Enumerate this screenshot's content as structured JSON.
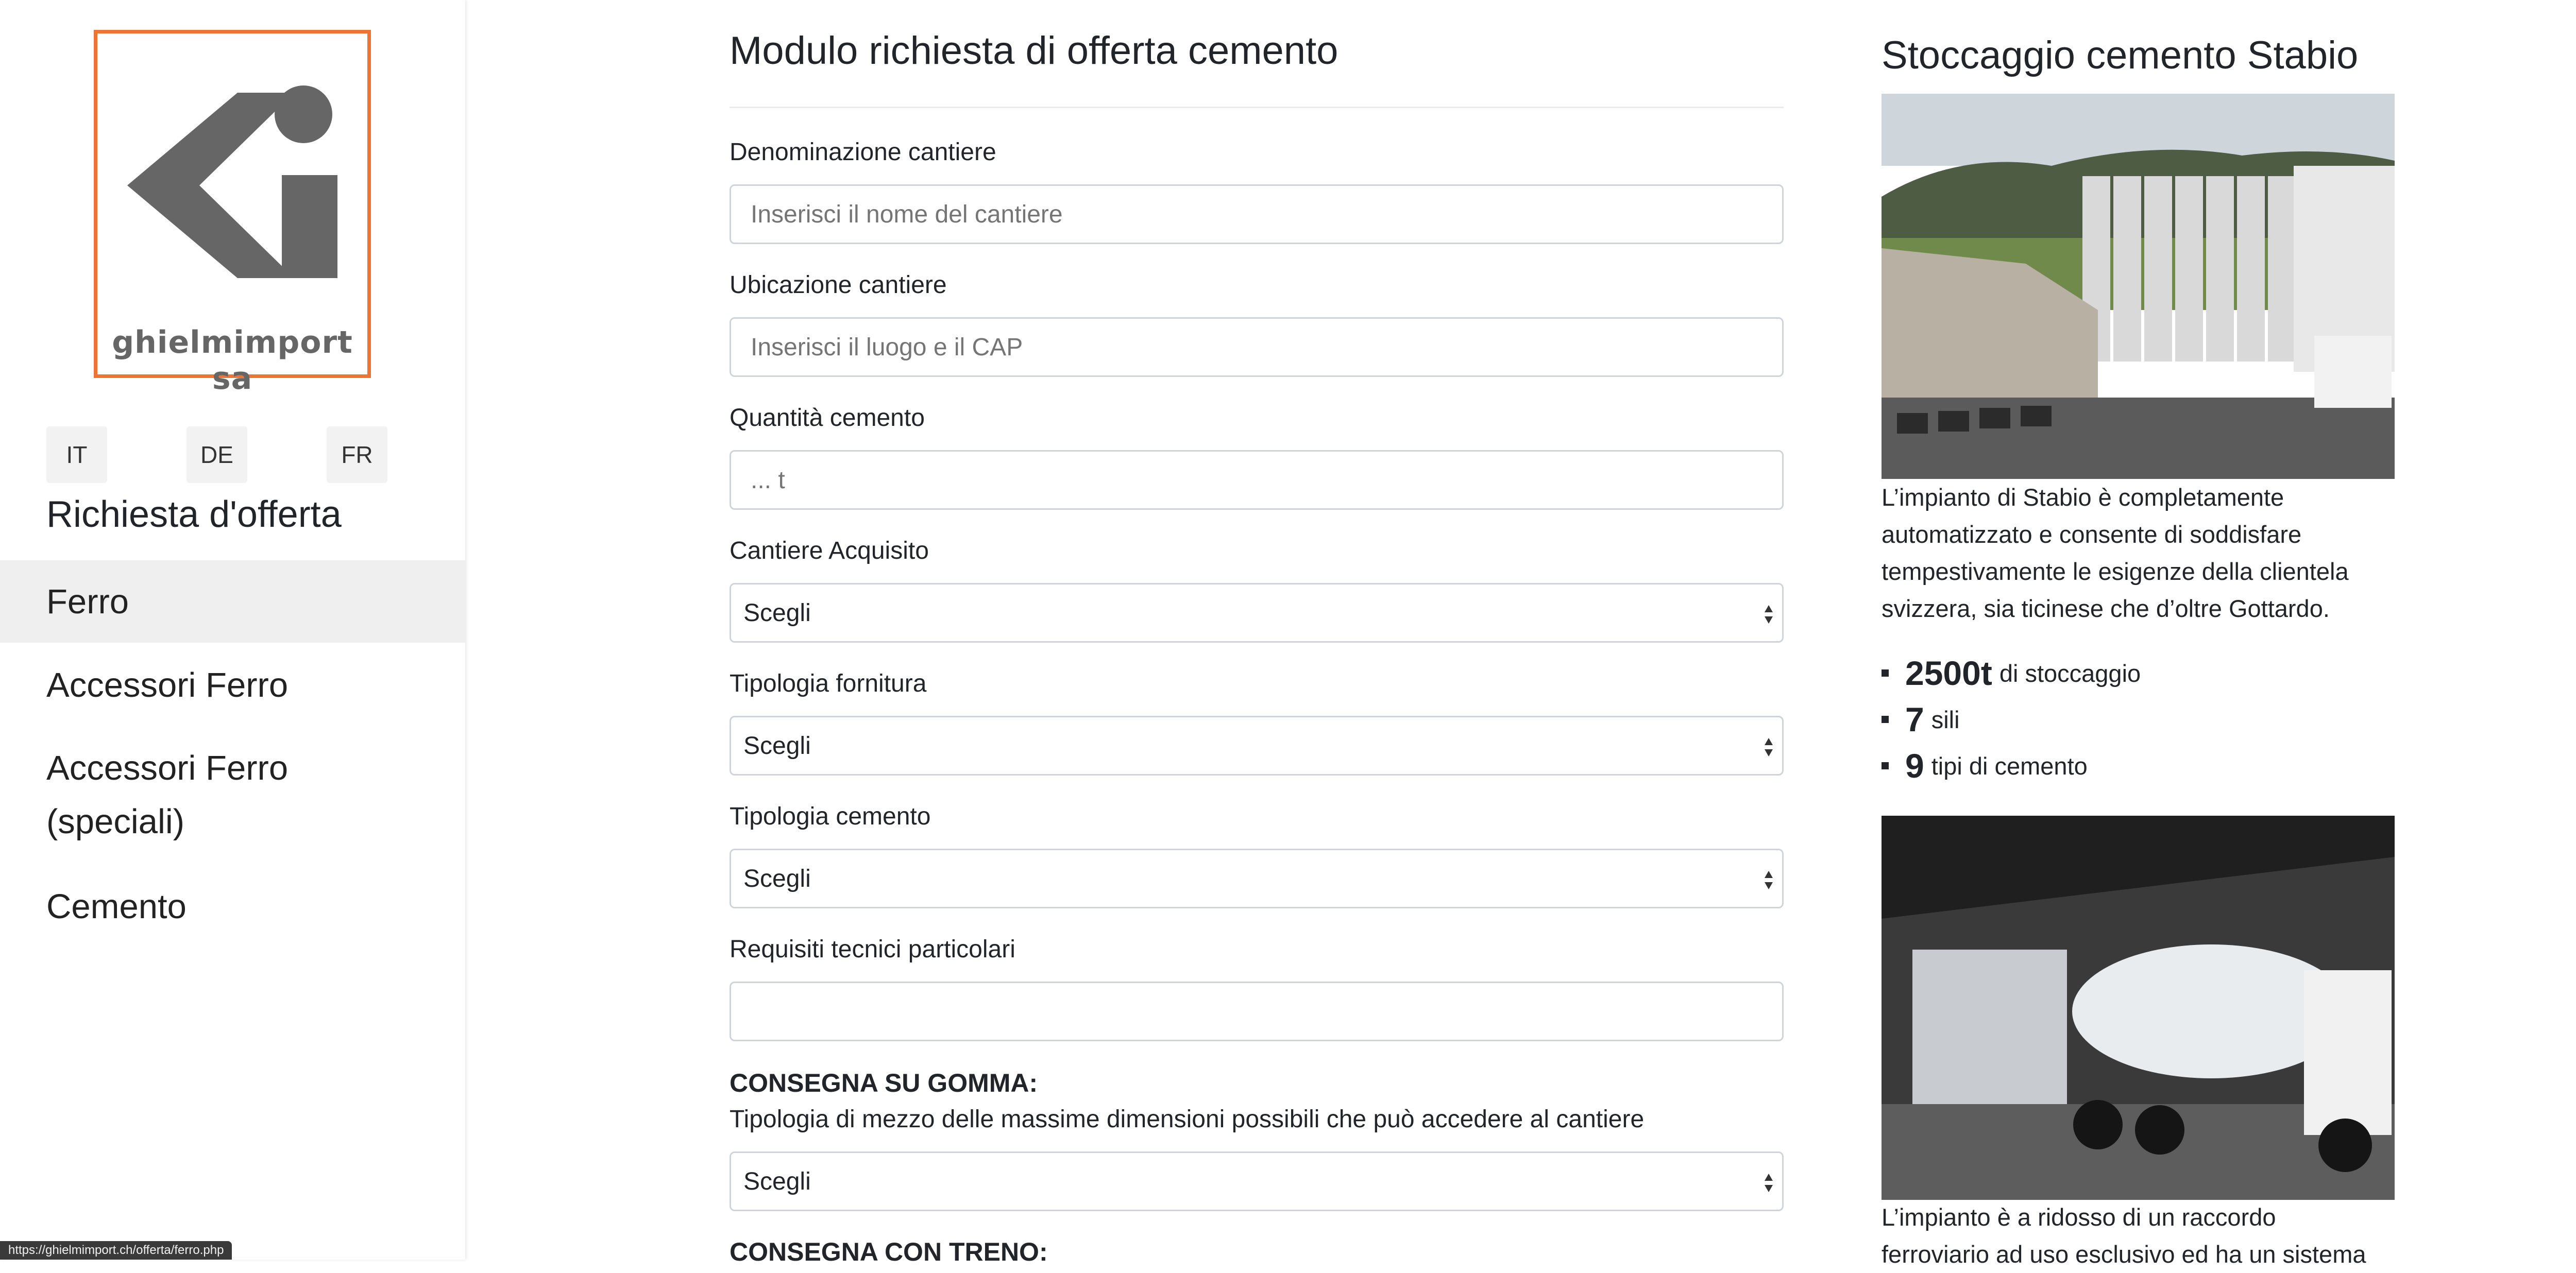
{
  "logo": {
    "company": "ghielmimport sa"
  },
  "languages": [
    "IT",
    "DE",
    "FR"
  ],
  "sidebar": {
    "heading": "Richiesta d'offerta",
    "items": [
      {
        "label": "Ferro",
        "active": true
      },
      {
        "label": "Accessori Ferro",
        "active": false
      },
      {
        "label": "Accessori Ferro (speciali)",
        "active": false
      },
      {
        "label": "Cemento",
        "active": false
      }
    ]
  },
  "form": {
    "title": "Modulo richiesta di offerta cemento",
    "fields": [
      {
        "label": "Denominazione cantiere",
        "type": "input",
        "placeholder": "Inserisci il nome del cantiere"
      },
      {
        "label": "Ubicazione cantiere",
        "type": "input",
        "placeholder": "Inserisci il luogo e il CAP"
      },
      {
        "label": "Quantità cemento",
        "type": "input",
        "placeholder": "... t"
      },
      {
        "label": "Cantiere Acquisito",
        "type": "select",
        "value": "Scegli"
      },
      {
        "label": "Tipologia fornitura",
        "type": "select",
        "value": "Scegli"
      },
      {
        "label": "Tipologia cemento",
        "type": "select",
        "value": "Scegli"
      },
      {
        "label": "Requisiti tecnici particolari",
        "type": "input",
        "placeholder": ""
      }
    ],
    "delivery_road": {
      "heading": "CONSEGNA SU GOMMA:",
      "description": "Tipologia di mezzo delle massime dimensioni possibili che può accedere al cantiere",
      "value": "Scegli"
    },
    "delivery_train": {
      "heading": "CONSEGNA CON TRENO:"
    }
  },
  "storage": {
    "title": "Stoccaggio cemento Stabio",
    "description": "L’impianto di Stabio è completamente automatizzato e consente di soddisfare tempestivamente le esigenze della clientela svizzera, sia ticinese che d’oltre Gottardo.",
    "stats": [
      {
        "value": "2500t",
        "label": "di stoccaggio"
      },
      {
        "value": "7",
        "label": "sili"
      },
      {
        "value": "9",
        "label": "tipi di cemento"
      }
    ],
    "description2_line1": "L’impianto è a ridosso di un raccordo",
    "description2_line2": "ferroviario ad uso esclusivo ed ha un sistema"
  },
  "status_url": "https://ghielmimport.ch/offerta/ferro.php",
  "colors": {
    "logo_border": "#ee7434",
    "logo_gray": "#666666",
    "active_nav_bg": "#efefef"
  },
  "icons": [
    "logo-ki-icon",
    "select-arrows-icon"
  ]
}
